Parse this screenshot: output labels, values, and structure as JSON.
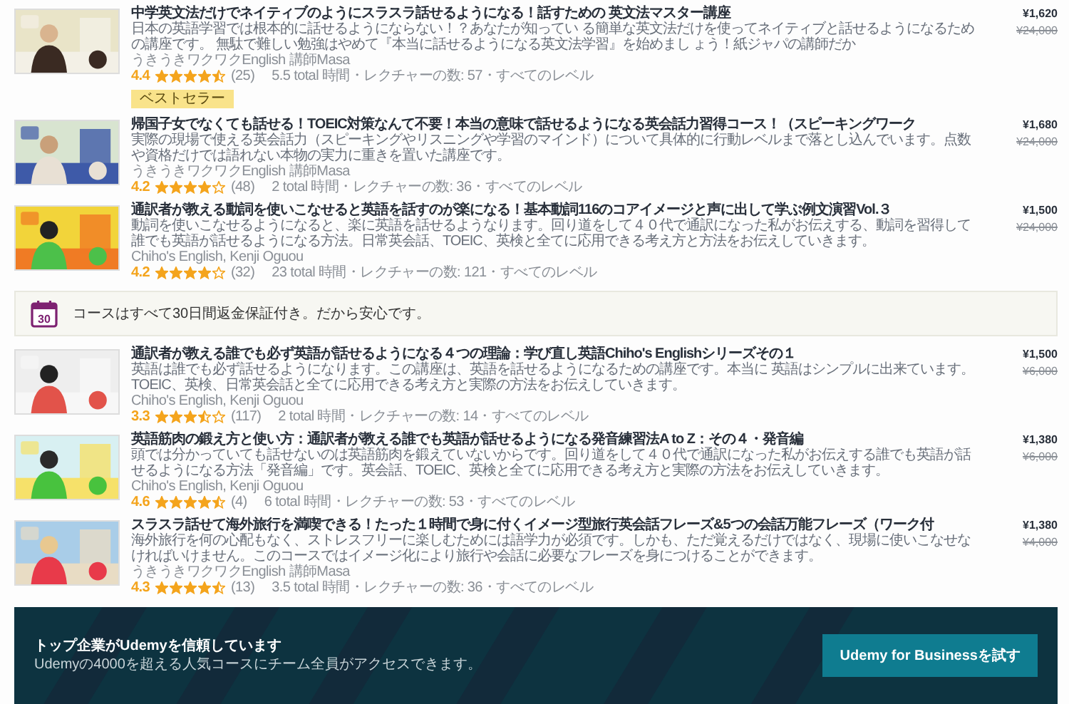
{
  "courses_top": [
    {
      "title": "中学英文法だけでネイティブのようにスラスラ話せるようになる！話すための 英文法マスター講座",
      "description": "日本の英語学習では根本的に話せるようにならない！？あなたが知ってい る簡単な英文法だけを使ってネイティブと話せるようになるための講座です。 無駄で難しい勉強はやめて『本当に話せるようになる英文法学習』を始めまし ょう！紙ジャパの講師だか",
      "author": "うきうきワクワクEnglish 講師Masa",
      "rating": "4.4",
      "stars": 4.5,
      "reviews": "(25)",
      "meta": "5.5 total 時間・レクチャーの数: 57・すべてのレベル",
      "badge": "ベストセラー",
      "price": "¥1,620",
      "original_price": "¥24,000"
    },
    {
      "title": "帰国子女でなくても話せる！TOEIC対策なんて不要！本当の意味で話せるようになる英会話力習得コース！（スピーキングワーク",
      "description": "実際の現場で使える英会話力（スピーキングやリスニングや学習のマインド）について具体的に行動レベルまで落とし込んでいます。点数や資格だけでは語れない本物の実力に重きを置いた講座です。",
      "author": "うきうきワクワクEnglish 講師Masa",
      "rating": "4.2",
      "stars": 4,
      "reviews": "(48)",
      "meta": "2 total 時間・レクチャーの数: 36・すべてのレベル",
      "price": "¥1,680",
      "original_price": "¥24,000"
    },
    {
      "title": "通訳者が教える動詞を使いこなせると英語を話すのが楽になる！基本動詞116のコアイメージと声に出して学ぶ例文演習Vol.３",
      "description": "動詞を使いこなせるようになると、楽に英語を話せるようなります。回り道をして４０代で通訳になった私がお伝えする、動詞を習得して誰でも英語が話せるようになる方法。日常英会話、TOEIC、英検と全てに応用できる考え方と方法をお伝えしていきます。",
      "author": "Chiho's English, Kenji Oguou",
      "rating": "4.2",
      "stars": 4,
      "reviews": "(32)",
      "meta": "23 total 時間・レクチャーの数: 121・すべてのレベル",
      "price": "¥1,500",
      "original_price": "¥24,000"
    }
  ],
  "guarantee": {
    "day_number": "30",
    "text": "コースはすべて30日間返金保証付き。だから安心です。"
  },
  "courses_bottom": [
    {
      "title": "通訳者が教える誰でも必ず英語が話せるようになる４つの理論：学び直し英語Chiho's Englishシリーズその１",
      "description": "英語は誰でも必ず話せるようになります。この講座は、英語を話せるようになるための講座です。本当に 英語はシンプルに出来ています。TOEIC、英検、日常英会話と全てに応用できる考え方と実際の方法をお伝えしていきます。",
      "author": "Chiho's English, Kenji Oguou",
      "rating": "3.3",
      "stars": 3.5,
      "reviews": "(117)",
      "meta": "2 total 時間・レクチャーの数: 14・すべてのレベル",
      "price": "¥1,500",
      "original_price": "¥6,000"
    },
    {
      "title": "英語筋肉の鍛え方と使い方：通訳者が教える誰でも英語が話せるようになる発音練習法A to Z：その４・発音編",
      "description": "頭では分かっていても話せないのは英語筋肉を鍛えていないからです。回り道をして４０代で通訳になった私がお伝えする誰でも英語が話せるようになる方法「発音編」です。英会話、TOEIC、英検と全てに応用できる考え方と実際の方法をお伝えしていきます。",
      "author": "Chiho's English, Kenji Oguou",
      "rating": "4.6",
      "stars": 4.5,
      "reviews": "(4)",
      "meta": "6 total 時間・レクチャーの数: 53・すべてのレベル",
      "price": "¥1,380",
      "original_price": "¥6,000"
    },
    {
      "title": "スラスラ話せて海外旅行を満喫できる！たった１時間で身に付くイメージ型旅行英会話フレーズ&5つの会話万能フレーズ（ワーク付",
      "description": "海外旅行を何の心配もなく、ストレスフリーに楽しむためには語学力が必須です。しかも、ただ覚えるだけではなく、現場に使いこなせなければいけません。このコースではイメージ化により旅行や会話に必要なフレーズを身につけることができます。",
      "author": "うきうきワクワクEnglish 講師Masa",
      "rating": "4.3",
      "stars": 4.5,
      "reviews": "(13)",
      "meta": "3.5 total 時間・レクチャーの数: 36・すべてのレベル",
      "price": "¥1,380",
      "original_price": "¥4,000"
    }
  ],
  "business_banner": {
    "title": "トップ企業がUdemyを信頼しています",
    "subtitle": "Udemyの4000を超える人気コースにチーム全員がアクセスできます。",
    "button": "Udemy for Businessを試す"
  }
}
